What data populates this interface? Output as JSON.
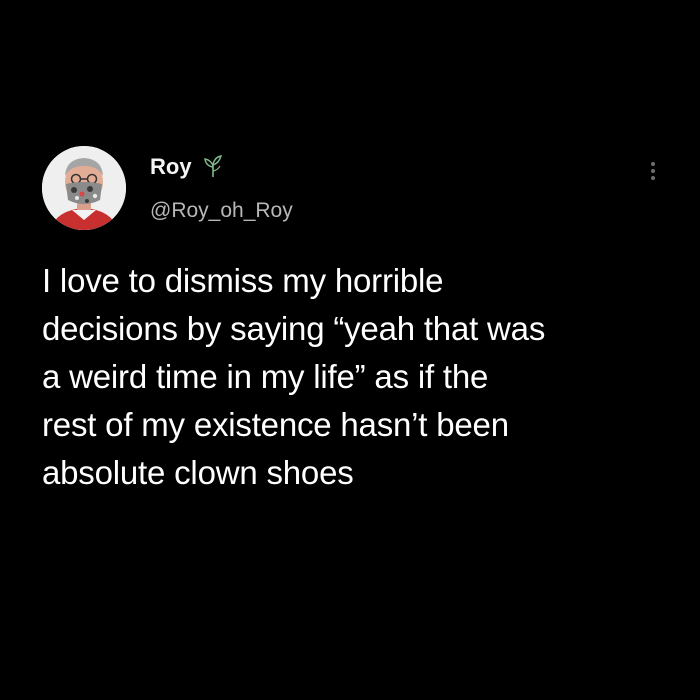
{
  "author": {
    "display_name": "Roy",
    "handle": "@Roy_oh_Roy",
    "avatar_icon": "user-avatar",
    "badge_icon": "plant-icon"
  },
  "menu": {
    "icon": "more-options-icon"
  },
  "tweet": {
    "lines": [
      "I love to dismiss my horrible",
      "decisions by saying “yeah that was",
      "a weird time in my life” as if the",
      "rest of my existence hasn’t been",
      "absolute clown shoes"
    ]
  },
  "colors": {
    "background": "#000000",
    "text": "#ffffff",
    "handle": "#b7b7b7"
  }
}
